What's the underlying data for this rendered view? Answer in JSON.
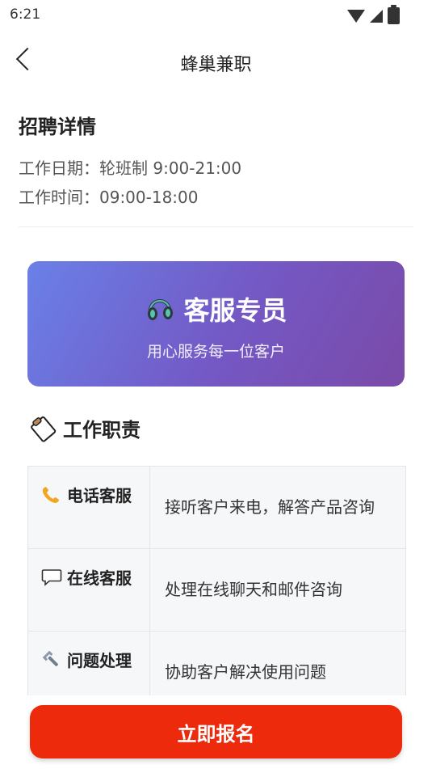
{
  "status_bar": {
    "time": "6:21"
  },
  "header": {
    "title": "蜂巢兼职"
  },
  "details": {
    "section_title": "招聘详情",
    "work_date": "工作日期：轮班制 9:00-21:00",
    "work_time": "工作时间：09:00-18:00"
  },
  "hero": {
    "icon": "headset-icon",
    "title": "客服专员",
    "subtitle": "用心服务每一位客户",
    "gradient_start": "#6a80e8",
    "gradient_end": "#7a4aa8"
  },
  "duties": {
    "icon": "clipboard-icon",
    "title": "工作职责",
    "rows": [
      {
        "icon": "phone-icon",
        "label": "电话客服",
        "description": "接听客户来电，解答产品咨询"
      },
      {
        "icon": "chat-bubble-icon",
        "label": "在线客服",
        "description": "处理在线聊天和邮件咨询"
      },
      {
        "icon": "wrench-icon",
        "label": "问题处理",
        "description": "协助客户解决使用问题"
      }
    ]
  },
  "apply_button": {
    "label": "立即报名",
    "color": "#ee2a0c"
  }
}
